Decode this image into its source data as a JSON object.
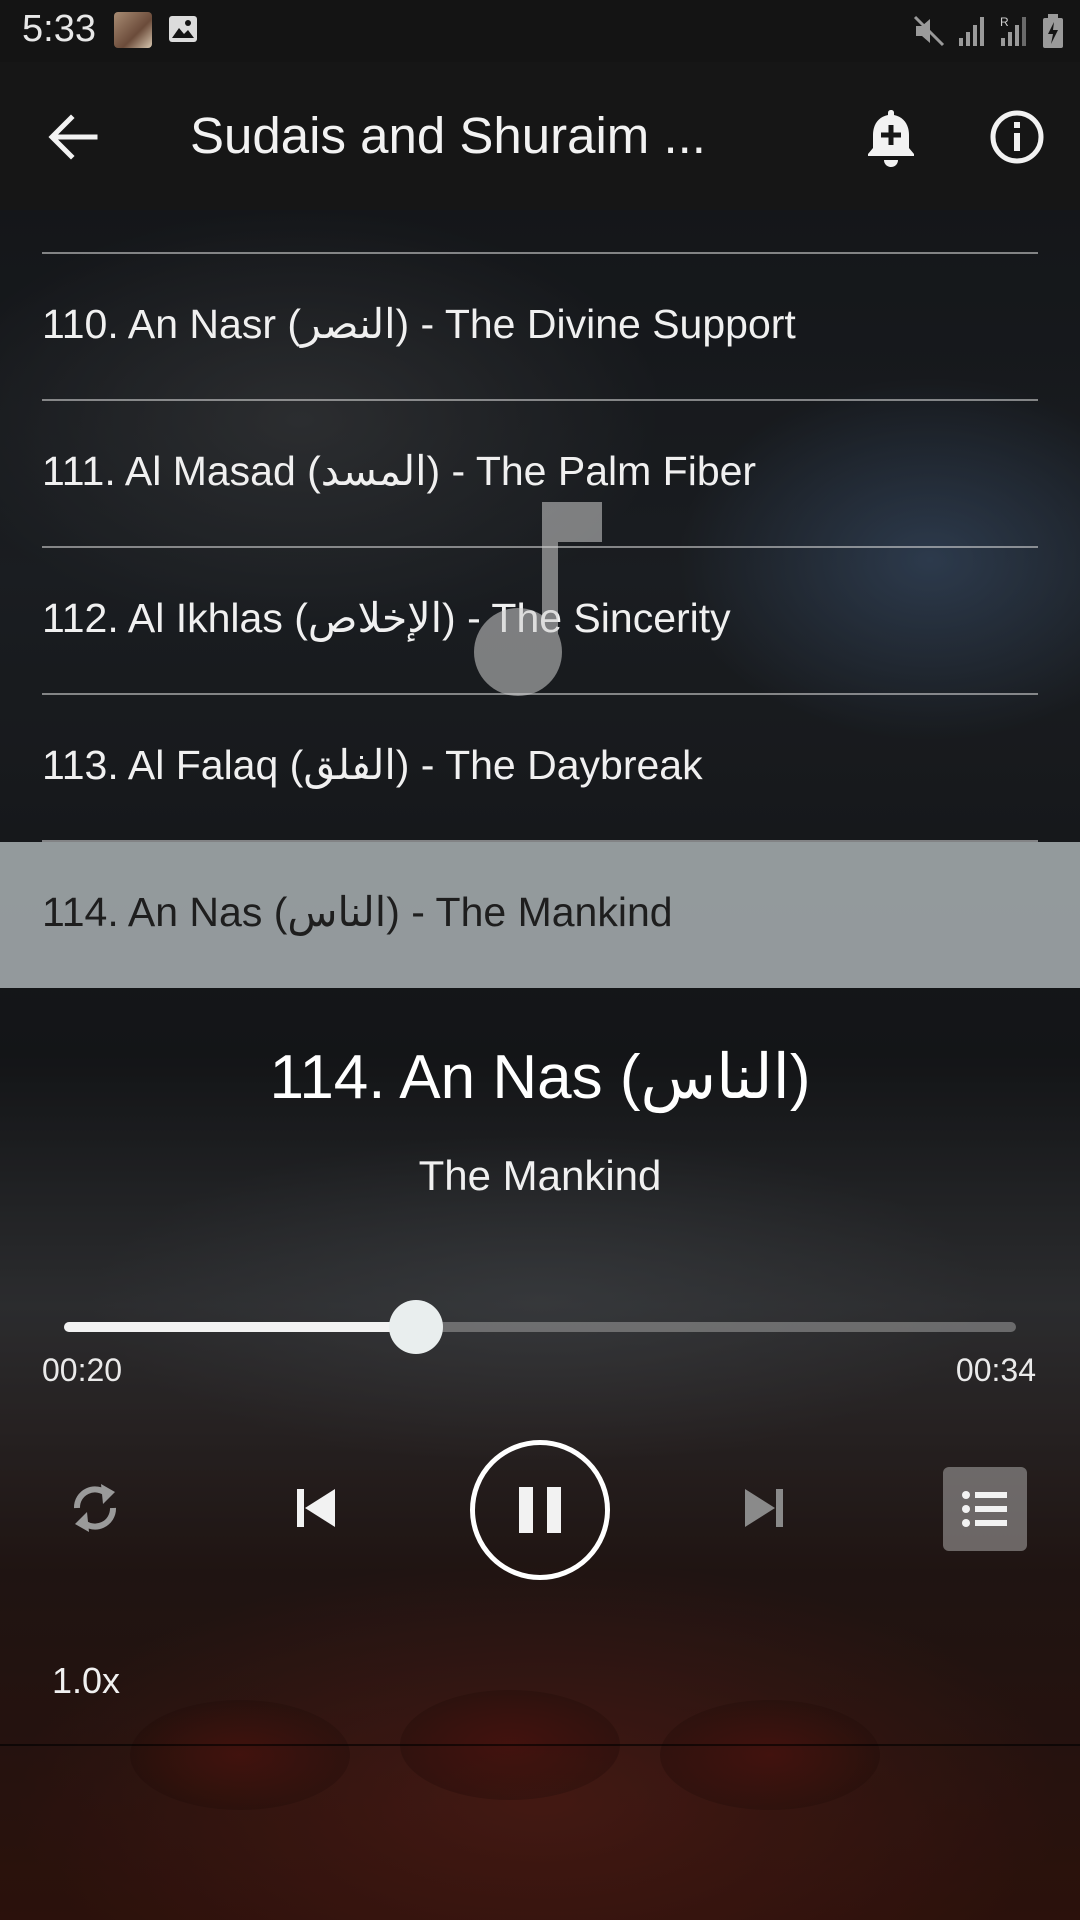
{
  "status_bar": {
    "time": "5:33",
    "icons": [
      "notification-thumbnail",
      "image-icon",
      "mute-icon",
      "signal-icon",
      "roaming-signal-icon",
      "battery-charging-icon"
    ]
  },
  "toolbar": {
    "title": "Sudais and Shuraim ...",
    "back_icon": "arrow-left-icon",
    "add_alarm_icon": "bell-plus-icon",
    "info_icon": "info-icon"
  },
  "tracks": [
    {
      "label": "110. An Nasr (النصر) - The Divine Support",
      "active": false
    },
    {
      "label": "111. Al Masad (المسد) - The Palm Fiber",
      "active": false
    },
    {
      "label": "112. Al Ikhlas (الإخلاص) - The Sincerity",
      "active": false
    },
    {
      "label": "113. Al Falaq (الفلق) - The Daybreak",
      "active": false
    },
    {
      "label": "114. An Nas (الناس) - The Mankind",
      "active": true
    }
  ],
  "now_playing": {
    "title": "114. An Nas (الناس)",
    "subtitle": "The Mankind"
  },
  "progress": {
    "elapsed": "00:20",
    "total": "00:34",
    "fraction": 0.37
  },
  "controls": {
    "repeat_icon": "repeat-icon",
    "previous_icon": "skip-previous-icon",
    "play_pause_icon": "pause-icon",
    "next_icon": "skip-next-icon",
    "playlist_icon": "list-icon"
  },
  "speed": "1.0x",
  "colors": {
    "active_row": "#bec6c8",
    "toolbar": "#161616",
    "accent": "#ffffff"
  }
}
